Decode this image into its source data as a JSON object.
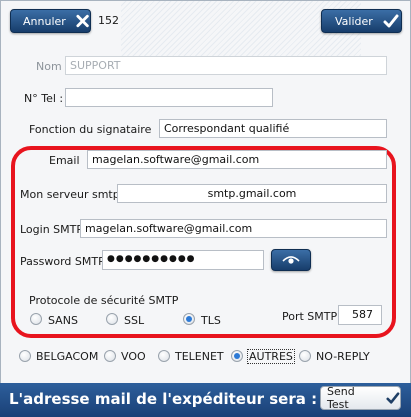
{
  "toolbar": {
    "cancel_label": "Annuler",
    "record_id": "152",
    "validate_label": "Valider"
  },
  "form": {
    "nom_label": "Nom",
    "nom_value": "SUPPORT",
    "tel_label": "N° Tel :",
    "tel_value": "",
    "fonction_label": "Fonction du signataire",
    "fonction_value": "Correspondant qualifié",
    "email_label": "Email",
    "email_value": "magelan.software@gmail.com",
    "server_label": "Mon serveur smtp",
    "server_value": "smtp.gmail.com",
    "login_label": "Login SMTP",
    "login_value": "magelan.software@gmail.com",
    "password_label": "Password SMTP",
    "password_value": "●●●●●●●●●●",
    "protocol_label": "Protocole de sécurité SMTP",
    "protocol_options": [
      "SANS",
      "SSL",
      "TLS"
    ],
    "protocol_selected": "TLS",
    "port_label": "Port SMTP",
    "port_value": "587"
  },
  "providers": {
    "options": [
      "BELGACOM",
      "VOO",
      "TELENET",
      "AUTRES",
      "NO-REPLY"
    ],
    "selected": "AUTRES"
  },
  "footer": {
    "text": "L'adresse mail de l'expéditeur sera :",
    "send_test_label": "Send Test"
  },
  "colors": {
    "accent": "#1f4f8a",
    "highlight": "#e8141e",
    "radio_on": "#2d7ad6"
  }
}
